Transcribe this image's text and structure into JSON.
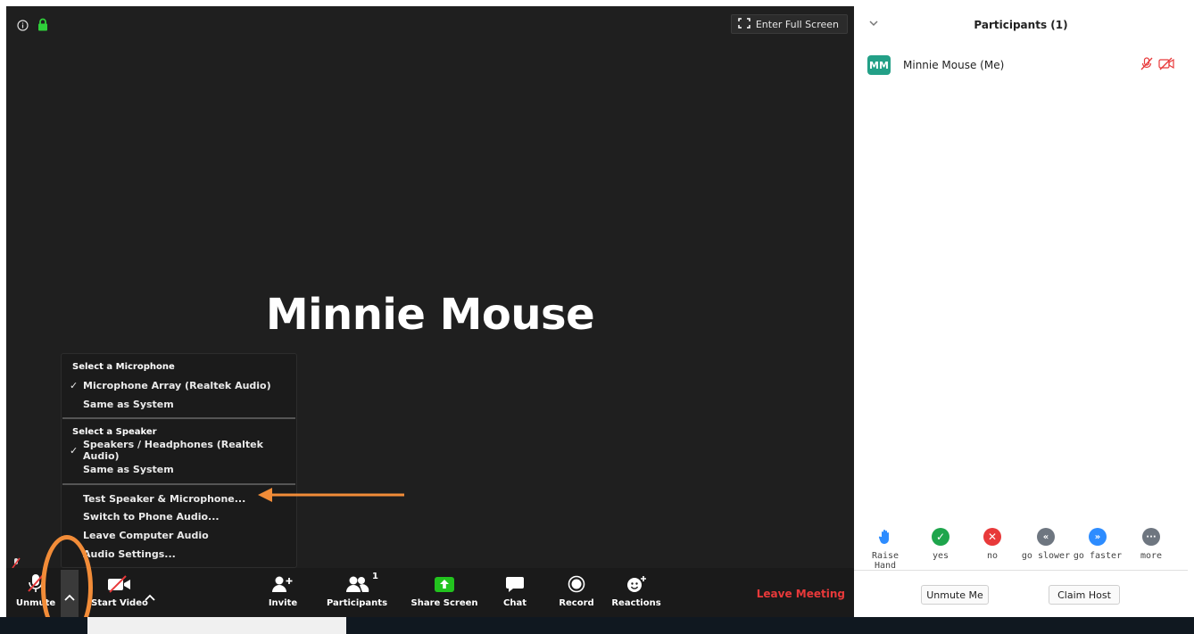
{
  "meeting": {
    "fullscreen_label": "Enter Full Screen",
    "participant_name": "Minnie Mouse"
  },
  "audio_menu": {
    "microphone_heading": "Select a Microphone",
    "microphone_options": [
      "Microphone Array (Realtek Audio)",
      "Same as System"
    ],
    "speaker_heading": "Select a Speaker",
    "speaker_options": [
      "Speakers / Headphones (Realtek Audio)",
      "Same as System"
    ],
    "actions": [
      "Test Speaker & Microphone...",
      "Switch to Phone Audio...",
      "Leave Computer Audio",
      "Audio Settings..."
    ]
  },
  "toolbar": {
    "unmute": "Unmute",
    "start_video": "Start Video",
    "invite": "Invite",
    "participants": "Participants",
    "participants_count": "1",
    "share_screen": "Share Screen",
    "chat": "Chat",
    "record": "Record",
    "reactions": "Reactions",
    "leave": "Leave Meeting"
  },
  "panel": {
    "title": "Participants (1)",
    "participant": {
      "initials": "MM",
      "name": "Minnie Mouse (Me)"
    },
    "feedback": [
      {
        "label": "Raise Hand",
        "icon": "raise-hand-icon",
        "color": "#2d8cff"
      },
      {
        "label": "yes",
        "icon": "check-icon",
        "color": "#1ea54c"
      },
      {
        "label": "no",
        "icon": "x-icon",
        "color": "#e8393a"
      },
      {
        "label": "go slower",
        "icon": "rewind-icon",
        "color": "#6e7680"
      },
      {
        "label": "go faster",
        "icon": "fast-forward-icon",
        "color": "#2d8cff"
      },
      {
        "label": "more",
        "icon": "more-icon",
        "color": "#6e7680"
      }
    ],
    "unmute_me": "Unmute Me",
    "claim_host": "Claim Host"
  },
  "colors": {
    "leave": "#e8393a",
    "share": "#22c31e",
    "annotation": "#f28c38",
    "avatar": "#23a087"
  }
}
